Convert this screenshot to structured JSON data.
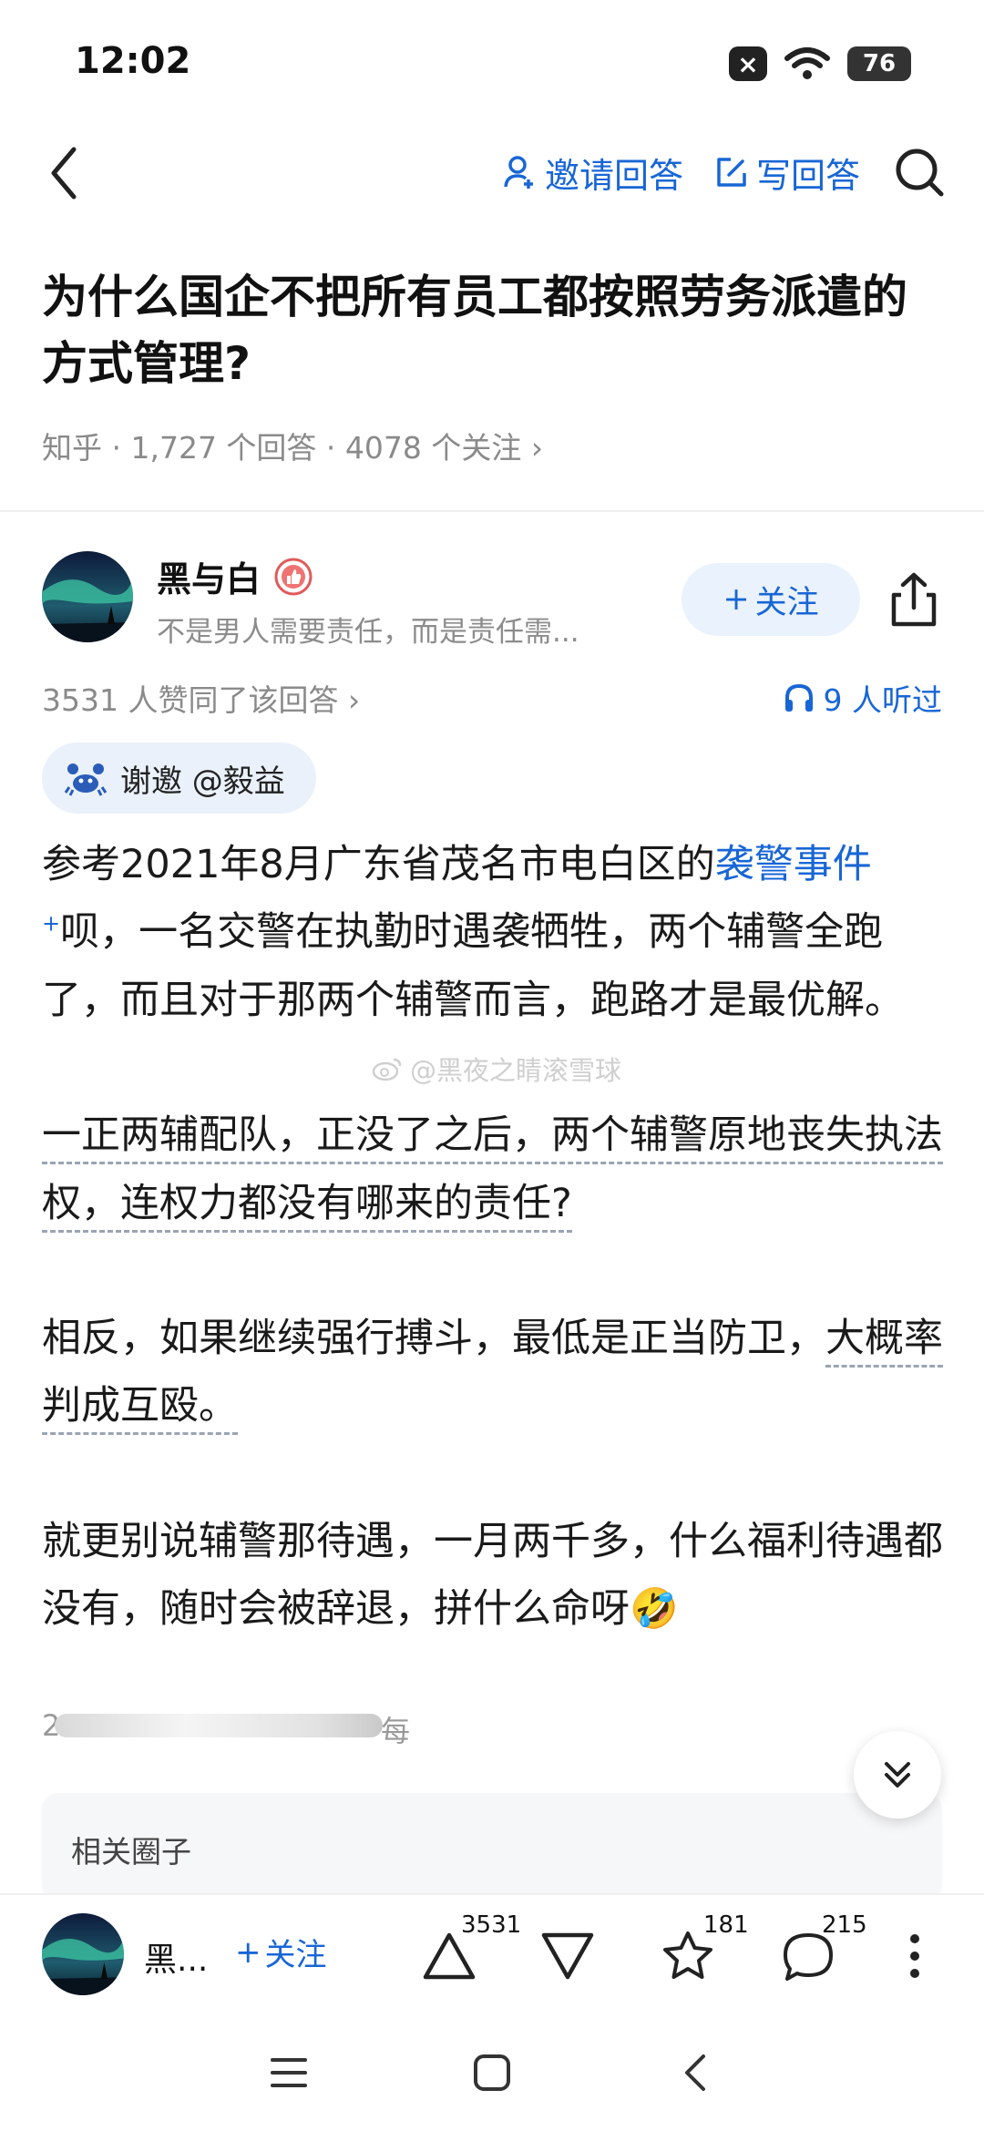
{
  "status": {
    "time": "12:02",
    "battery": "76",
    "close_icon": "×"
  },
  "nav": {
    "invite_label": "邀请回答",
    "write_label": "写回答"
  },
  "question": {
    "title": "为什么国企不把所有员工都按照劳务派遣的方式管理?",
    "meta": "知乎 · 1,727 个回答 · 4078 个关注 ›"
  },
  "author": {
    "name": "黑与白",
    "bio": "不是男人需要责任，而是责任需...",
    "follow_label": "关注",
    "follow_plus": "+"
  },
  "answer_stats": {
    "agree_text": "3531 人赞同了该回答 ›",
    "listen_text": "9 人听过"
  },
  "invite": {
    "text": "谢邀 @毅益"
  },
  "answer": {
    "p1_a": "参考2021年8月广东省茂名市电白区的",
    "p1_link": "袭警事件",
    "p1_sup": "+",
    "p1_b": "呗，一名交警在执勤时遇袭牺牲，两个辅警全跑了，而且对于那两个辅警而言，跑路才是最优解。",
    "p2": "一正两辅配队，正没了之后，两个辅警原地丧失执法权，连权力都没有哪来的责任?",
    "p3_a": "相反，如果继续强行搏斗，最低是正当防卫，",
    "p3_b": "大概率判成互殴。",
    "p4": "就更别说辅警那待遇，一月两千多，什么福利待遇都没有，随时会被辞退，拼什么命呀🤣",
    "blur_left": "2",
    "blur_right": "每"
  },
  "watermark": {
    "text": "@黑夜之睛滚雪球"
  },
  "related": {
    "label": "相关圈子"
  },
  "bottom_bar": {
    "author_name": "黑...",
    "follow_label": "关注",
    "follow_plus": "+",
    "upvote_count": "3531",
    "favorite_count": "181",
    "comment_count": "215"
  },
  "icons": [
    "back-icon",
    "user-plus-icon",
    "edit-icon",
    "search-icon",
    "share-icon",
    "headphones-icon",
    "crab-icon",
    "weibo-icon",
    "chevrons-down-icon",
    "upvote-icon",
    "downvote-icon",
    "star-icon",
    "comment-icon",
    "more-icon",
    "menu-icon",
    "home-square-icon"
  ],
  "colors": {
    "accent": "#1866d6",
    "badge_bg": "#eaf1fb"
  }
}
